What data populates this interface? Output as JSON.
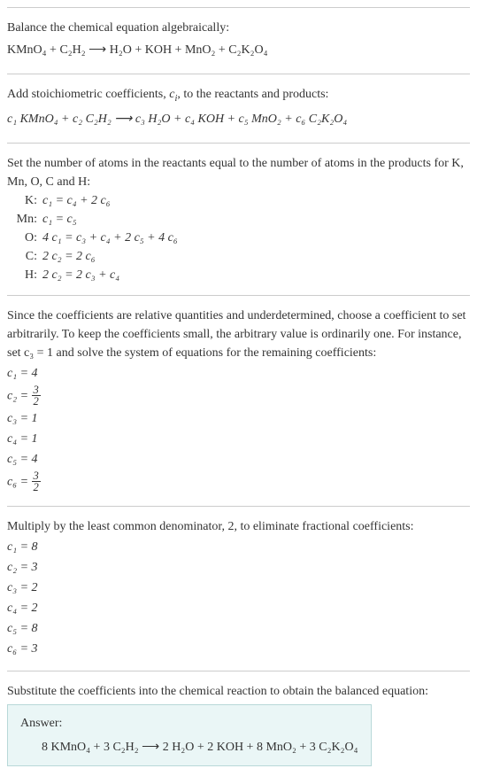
{
  "section1": {
    "intro": "Balance the chemical equation algebraically:",
    "equation": "KMnO₄ + C₂H₂ ⟶ H₂O + KOH + MnO₂ + C₂K₂O₄"
  },
  "section2": {
    "intro_before_ci": "Add stoichiometric coefficients, ",
    "intro_after_ci": ", to the reactants and products:",
    "equation": "c₁ KMnO₄ + c₂ C₂H₂ ⟶ c₃ H₂O + c₄ KOH + c₅ MnO₂ + c₆ C₂K₂O₄"
  },
  "section3": {
    "intro": "Set the number of atoms in the reactants equal to the number of atoms in the products for K, Mn, O, C and H:",
    "rows": [
      {
        "label": "K:",
        "eq": "c₁ = c₄ + 2 c₆"
      },
      {
        "label": "Mn:",
        "eq": "c₁ = c₅"
      },
      {
        "label": "O:",
        "eq": "4 c₁ = c₃ + c₄ + 2 c₅ + 4 c₆"
      },
      {
        "label": "C:",
        "eq": "2 c₂ = 2 c₆"
      },
      {
        "label": "H:",
        "eq": "2 c₂ = 2 c₃ + c₄"
      }
    ]
  },
  "section4": {
    "intro": "Since the coefficients are relative quantities and underdetermined, choose a coefficient to set arbitrarily. To keep the coefficients small, the arbitrary value is ordinarily one. For instance, set c₃ = 1 and solve the system of equations for the remaining coefficients:",
    "coefs": {
      "c1": "c₁ = 4",
      "c2_lhs": "c₂ = ",
      "c2_num": "3",
      "c2_den": "2",
      "c3": "c₃ = 1",
      "c4": "c₄ = 1",
      "c5": "c₅ = 4",
      "c6_lhs": "c₆ = ",
      "c6_num": "3",
      "c6_den": "2"
    }
  },
  "section5": {
    "intro": "Multiply by the least common denominator, 2, to eliminate fractional coefficients:",
    "coefs": [
      "c₁ = 8",
      "c₂ = 3",
      "c₃ = 2",
      "c₄ = 2",
      "c₅ = 8",
      "c₆ = 3"
    ]
  },
  "section6": {
    "intro": "Substitute the coefficients into the chemical reaction to obtain the balanced equation:",
    "answer_label": "Answer:",
    "answer_eq": "8 KMnO₄ + 3 C₂H₂ ⟶ 2 H₂O + 2 KOH + 8 MnO₂ + 3 C₂K₂O₄"
  },
  "chart_data": {
    "type": "table",
    "title": "Balancing chemical equation algebraically",
    "reaction": {
      "reactants": [
        "KMnO4",
        "C2H2"
      ],
      "products": [
        "H2O",
        "KOH",
        "MnO2",
        "C2K2O4"
      ]
    },
    "atom_balance_equations": {
      "K": "c1 = c4 + 2*c6",
      "Mn": "c1 = c5",
      "O": "4*c1 = c3 + c4 + 2*c5 + 4*c6",
      "C": "2*c2 = 2*c6",
      "H": "2*c2 = 2*c3 + c4"
    },
    "solution_with_c3_1": {
      "c1": 4,
      "c2": 1.5,
      "c3": 1,
      "c4": 1,
      "c5": 4,
      "c6": 1.5
    },
    "integer_solution": {
      "c1": 8,
      "c2": 3,
      "c3": 2,
      "c4": 2,
      "c5": 8,
      "c6": 3
    },
    "balanced_equation": "8 KMnO4 + 3 C2H2 -> 2 H2O + 2 KOH + 8 MnO2 + 3 C2K2O4"
  }
}
